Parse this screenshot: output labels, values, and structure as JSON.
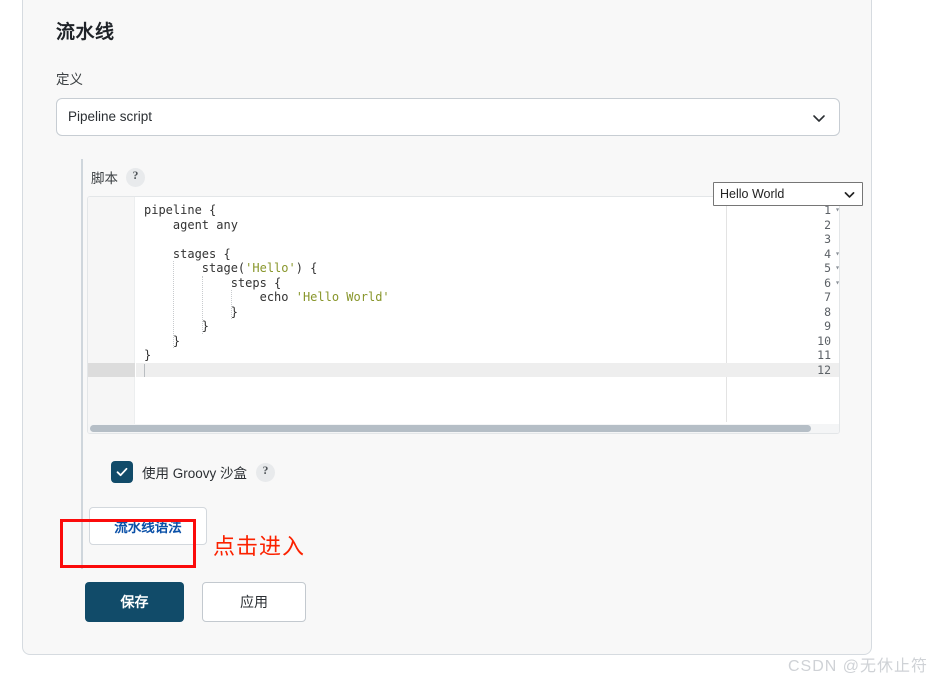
{
  "page": {
    "title": "流水线"
  },
  "definition": {
    "label": "定义",
    "selected": "Pipeline script",
    "chevron_icon": "chevron-down-icon"
  },
  "script": {
    "label": "脚本",
    "help_icon": "?",
    "sample_selected": "Hello World",
    "sample_chevron_icon": "chevron-down-icon",
    "active_line": 12,
    "total_lines": 12,
    "lines": [
      {
        "n": 1,
        "fold": true,
        "segments": [
          {
            "t": "pipeline {",
            "k": "plain"
          }
        ]
      },
      {
        "n": 2,
        "fold": false,
        "segments": [
          {
            "t": "    agent any",
            "k": "plain"
          }
        ]
      },
      {
        "n": 3,
        "fold": false,
        "segments": [
          {
            "t": "",
            "k": "plain"
          }
        ]
      },
      {
        "n": 4,
        "fold": true,
        "segments": [
          {
            "t": "    stages {",
            "k": "plain"
          }
        ]
      },
      {
        "n": 5,
        "fold": true,
        "segments": [
          {
            "t": "        stage(",
            "k": "plain"
          },
          {
            "t": "'Hello'",
            "k": "str"
          },
          {
            "t": ") {",
            "k": "plain"
          }
        ]
      },
      {
        "n": 6,
        "fold": true,
        "segments": [
          {
            "t": "            steps {",
            "k": "plain"
          }
        ]
      },
      {
        "n": 7,
        "fold": false,
        "segments": [
          {
            "t": "                echo ",
            "k": "plain"
          },
          {
            "t": "'Hello World'",
            "k": "str"
          }
        ]
      },
      {
        "n": 8,
        "fold": false,
        "segments": [
          {
            "t": "            }",
            "k": "plain"
          }
        ]
      },
      {
        "n": 9,
        "fold": false,
        "segments": [
          {
            "t": "        }",
            "k": "plain"
          }
        ]
      },
      {
        "n": 10,
        "fold": false,
        "segments": [
          {
            "t": "    }",
            "k": "plain"
          }
        ]
      },
      {
        "n": 11,
        "fold": false,
        "segments": [
          {
            "t": "}",
            "k": "plain"
          }
        ]
      },
      {
        "n": 12,
        "fold": false,
        "segments": [
          {
            "t": "",
            "k": "plain"
          }
        ]
      }
    ]
  },
  "sandbox": {
    "label": "使用 Groovy 沙盒",
    "checked": true,
    "help_icon": "?",
    "check_icon": "check-icon"
  },
  "syntax_button": {
    "label": "流水线语法"
  },
  "annotation": {
    "note": "点击进入",
    "box_color": "#fb0b0b",
    "text_color": "#fb2200"
  },
  "actions": {
    "save_label": "保存",
    "apply_label": "应用"
  },
  "watermark": {
    "text": "CSDN @无休止符"
  },
  "colors": {
    "accent": "#114b69",
    "link": "#0b51a8",
    "card_bg": "#f8f8f8",
    "string_token": "#88962b"
  }
}
